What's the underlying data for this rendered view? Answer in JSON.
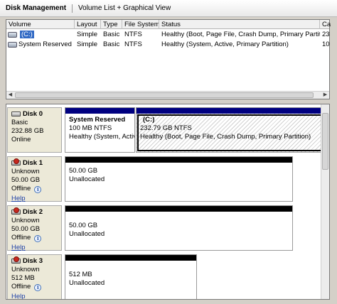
{
  "titlebar": {
    "title": "Disk Management",
    "subtitle": "Volume List + Graphical View"
  },
  "volume_list": {
    "columns": [
      "Volume",
      "Layout",
      "Type",
      "File System",
      "Status",
      "Ca"
    ],
    "rows": [
      {
        "volume": "(C:)",
        "layout": "Simple",
        "type": "Basic",
        "file_system": "NTFS",
        "status": "Healthy (Boot, Page File, Crash Dump, Primary Partition)",
        "capacity": "23",
        "selected": true
      },
      {
        "volume": "System Reserved",
        "layout": "Simple",
        "type": "Basic",
        "file_system": "NTFS",
        "status": "Healthy (System, Active, Primary Partition)",
        "capacity": "10",
        "selected": false
      }
    ]
  },
  "disks": [
    {
      "name": "Disk 0",
      "type": "Basic",
      "size": "232.88 GB",
      "state": "Online",
      "partitions": [
        {
          "name": "System Reserved",
          "size": "100 MB NTFS",
          "status": "Healthy (System, Activ"
        },
        {
          "name": "(C:)",
          "size": "232.79 GB NTFS",
          "status": "Healthy (Boot, Page File, Crash Dump, Primary Partition)"
        }
      ]
    },
    {
      "name": "Disk 1",
      "type": "Unknown",
      "size": "50.00 GB",
      "state": "Offline",
      "help": "Help",
      "partitions": [
        {
          "size": "50.00 GB",
          "status": "Unallocated"
        }
      ]
    },
    {
      "name": "Disk 2",
      "type": "Unknown",
      "size": "50.00 GB",
      "state": "Offline",
      "help": "Help",
      "partitions": [
        {
          "size": "50.00 GB",
          "status": "Unallocated"
        }
      ]
    },
    {
      "name": "Disk 3",
      "type": "Unknown",
      "size": "512 MB",
      "state": "Offline",
      "help": "Help",
      "partitions": [
        {
          "size": "512 MB",
          "status": "Unallocated"
        }
      ]
    }
  ],
  "icons": {
    "volume": "drive-icon",
    "disk": "disk-icon",
    "offline_disk": "disk-offline-icon",
    "info": "info-icon"
  },
  "colors": {
    "primary_partition_bar": "#000080",
    "unallocated_bar": "#000000",
    "selection": "#316ac5",
    "link": "#1c3fa6"
  }
}
